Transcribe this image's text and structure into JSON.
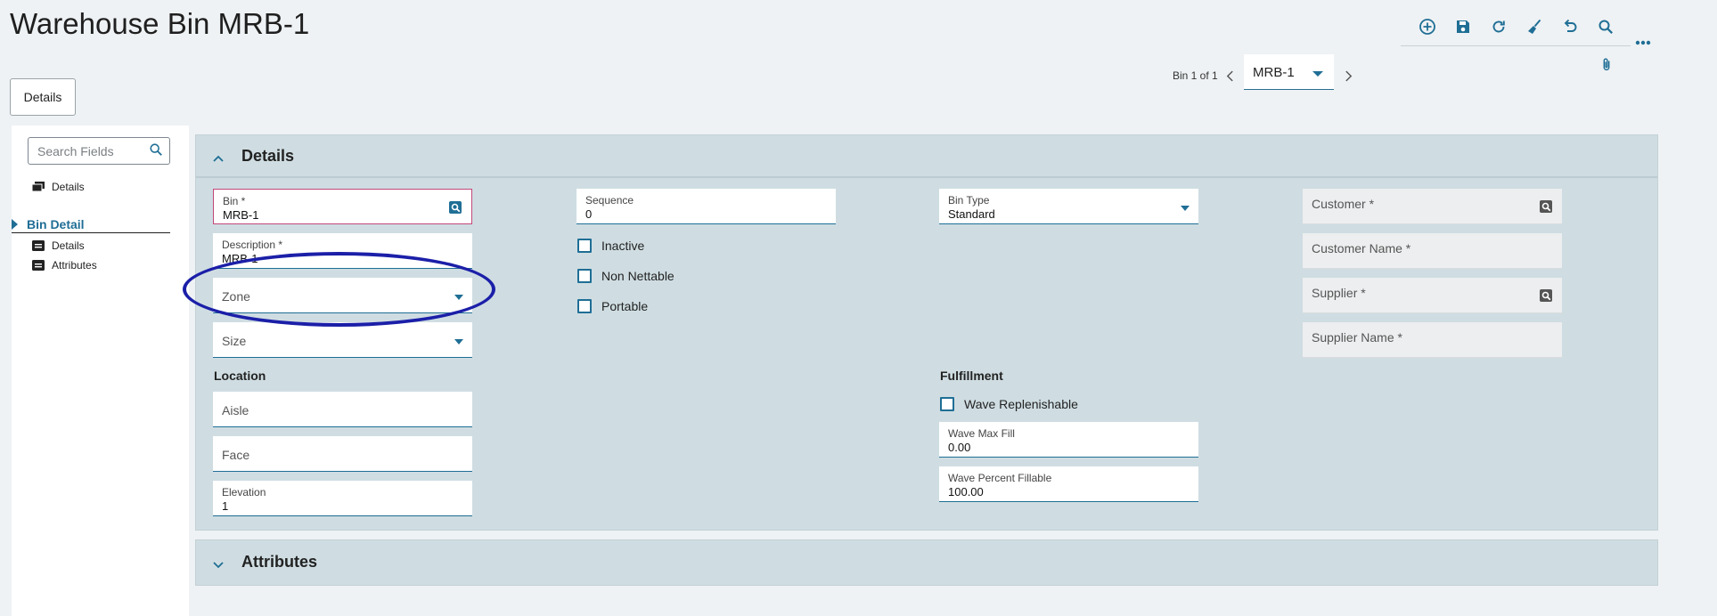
{
  "page": {
    "title": "Warehouse Bin MRB-1"
  },
  "toolbar": {
    "icons": [
      "add-icon",
      "save-icon",
      "refresh-icon",
      "clear-icon",
      "undo-icon",
      "search-icon",
      "more-icon",
      "attachment-icon"
    ]
  },
  "record_nav": {
    "counter": "Bin 1 of 1",
    "selected": "MRB-1"
  },
  "tabs": {
    "details": "Details"
  },
  "left_nav": {
    "search_placeholder": "Search Fields",
    "top_item": "Details",
    "tree_header": "Bin Detail",
    "sub_items": [
      "Details",
      "Attributes"
    ]
  },
  "details_section": {
    "title": "Details",
    "col1": {
      "bin": {
        "label": "Bin *",
        "value": "MRB-1"
      },
      "description": {
        "label": "Description *",
        "value": "MRB-1"
      },
      "zone": {
        "label": "Zone"
      },
      "size": {
        "label": "Size"
      },
      "location_label": "Location",
      "aisle": {
        "label": "Aisle"
      },
      "face": {
        "label": "Face"
      },
      "elevation": {
        "label": "Elevation",
        "value": "1"
      }
    },
    "col2": {
      "sequence": {
        "label": "Sequence",
        "value": "0"
      },
      "checkboxes": [
        {
          "label": "Inactive",
          "checked": false
        },
        {
          "label": "Non Nettable",
          "checked": false
        },
        {
          "label": "Portable",
          "checked": false
        }
      ]
    },
    "col3": {
      "bin_type": {
        "label": "Bin Type",
        "value": "Standard"
      },
      "fulfillment_label": "Fulfillment",
      "wave_replenishable": {
        "label": "Wave Replenishable",
        "checked": false
      },
      "wave_max_fill": {
        "label": "Wave Max Fill",
        "value": "0.00"
      },
      "wave_percent_fillable": {
        "label": "Wave Percent Fillable",
        "value": "100.00"
      }
    },
    "col4": {
      "customer": {
        "label": "Customer *"
      },
      "customer_name": {
        "label": "Customer Name *"
      },
      "supplier": {
        "label": "Supplier *"
      },
      "supplier_name": {
        "label": "Supplier Name *"
      }
    }
  },
  "attributes_section": {
    "title": "Attributes"
  },
  "colors": {
    "accent": "#1f6e95",
    "section_bg": "#cfdde2",
    "annotation": "#1b1fa8",
    "error_border": "#c2477a"
  }
}
